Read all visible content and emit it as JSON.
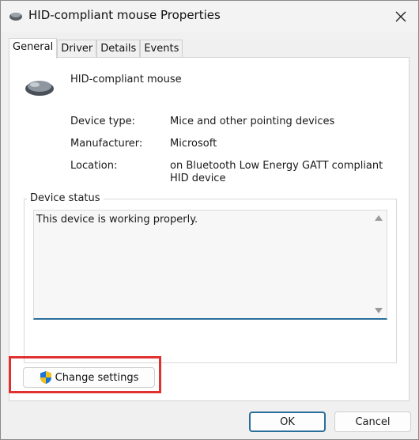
{
  "window": {
    "title": "HID-compliant mouse Properties"
  },
  "tabs": [
    {
      "label": "General",
      "active": true
    },
    {
      "label": "Driver",
      "active": false
    },
    {
      "label": "Details",
      "active": false
    },
    {
      "label": "Events",
      "active": false
    }
  ],
  "device": {
    "name": "HID-compliant mouse",
    "properties": [
      {
        "label": "Device type:",
        "value": "Mice and other pointing devices"
      },
      {
        "label": "Manufacturer:",
        "value": "Microsoft"
      },
      {
        "label": "Location:",
        "value": "on Bluetooth Low Energy GATT compliant HID device"
      }
    ]
  },
  "status": {
    "group_label": "Device status",
    "text": "This device is working properly."
  },
  "buttons": {
    "change_settings": "Change settings",
    "ok": "OK",
    "cancel": "Cancel"
  },
  "colors": {
    "accent": "#2a6e9c",
    "highlight": "#e03030"
  }
}
